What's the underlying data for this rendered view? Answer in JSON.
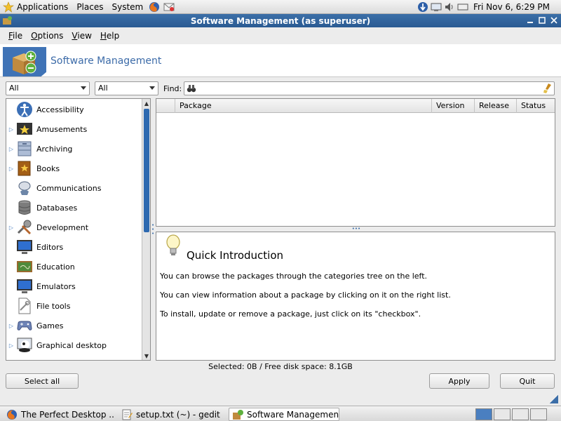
{
  "top_panel": {
    "menus": [
      "Applications",
      "Places",
      "System"
    ],
    "clock": "Fri Nov  6,  6:29 PM"
  },
  "window": {
    "title": "Software Management (as superuser)"
  },
  "menubar": [
    "File",
    "Options",
    "View",
    "Help"
  ],
  "banner": {
    "title": "Software Management"
  },
  "filters": {
    "filter1": "All",
    "filter2": "All",
    "find_label": "Find:",
    "find_value": ""
  },
  "categories": [
    {
      "label": "Accessibility",
      "icon": "accessibility-icon",
      "expandable": false
    },
    {
      "label": "Amusements",
      "icon": "amusements-icon",
      "expandable": true
    },
    {
      "label": "Archiving",
      "icon": "archiving-icon",
      "expandable": true
    },
    {
      "label": "Books",
      "icon": "books-icon",
      "expandable": true
    },
    {
      "label": "Communications",
      "icon": "communications-icon",
      "expandable": false
    },
    {
      "label": "Databases",
      "icon": "databases-icon",
      "expandable": false
    },
    {
      "label": "Development",
      "icon": "development-icon",
      "expandable": true
    },
    {
      "label": "Editors",
      "icon": "editors-icon",
      "expandable": false
    },
    {
      "label": "Education",
      "icon": "education-icon",
      "expandable": false
    },
    {
      "label": "Emulators",
      "icon": "emulators-icon",
      "expandable": false
    },
    {
      "label": "File tools",
      "icon": "file-tools-icon",
      "expandable": false
    },
    {
      "label": "Games",
      "icon": "games-icon",
      "expandable": true
    },
    {
      "label": "Graphical desktop",
      "icon": "graphical-desktop-icon",
      "expandable": true
    }
  ],
  "package_list": {
    "columns": [
      "Package",
      "Version",
      "Release",
      "Status"
    ]
  },
  "info": {
    "heading": "Quick Introduction",
    "lines": [
      "You can browse the packages through the categories tree on the left.",
      "You can view information about a package by clicking on it on the right list.",
      "To install, update or remove a package, just click on its \"checkbox\"."
    ]
  },
  "status": "Selected: 0B / Free disk space: 8.1GB",
  "buttons": {
    "select_all": "Select all",
    "apply": "Apply",
    "quit": "Quit"
  },
  "taskbar": {
    "tasks": [
      {
        "label": "The Perfect Desktop ...",
        "icon": "firefox-icon",
        "active": false
      },
      {
        "label": "setup.txt (~) - gedit",
        "icon": "text-editor-icon",
        "active": false
      },
      {
        "label": "Software Managemen...",
        "icon": "software-manager-icon",
        "active": true
      }
    ]
  },
  "colors": {
    "titlebar": "#2e5f98",
    "accent": "#3c6ba8",
    "selection_thumb": "#2d69b0"
  }
}
